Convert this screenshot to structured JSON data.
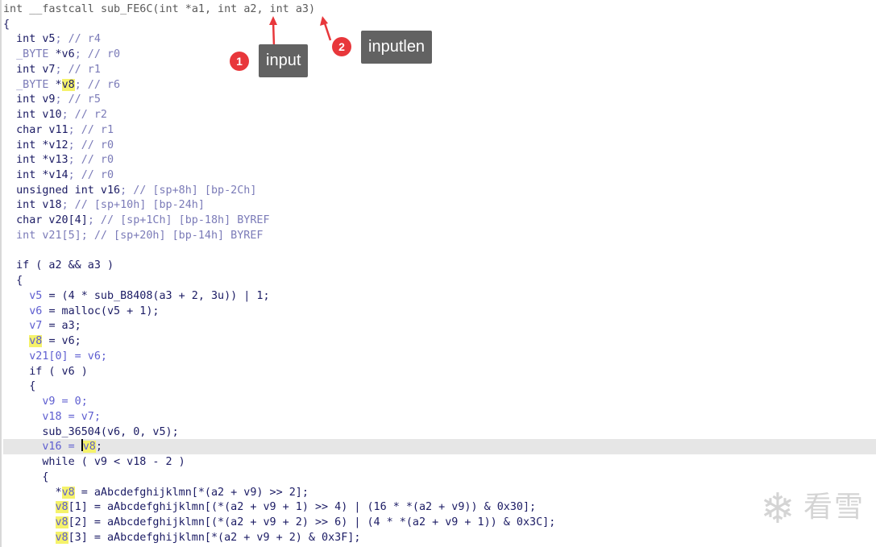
{
  "function_signature": {
    "int_kw": "int",
    "callconv": "__fastcall",
    "name": "sub_FE6C(int *",
    "a1": "a1",
    "sep1": ", int ",
    "a2": "a2",
    "sep2": ", int ",
    "a3": "a3",
    "close": ")"
  },
  "open_brace": "{",
  "declarations": [
    {
      "type": "int",
      "name": " v5",
      "comment": "; // r4"
    },
    {
      "type": "_BYTE",
      "name": " *v6",
      "comment": "; // r0"
    },
    {
      "type": "int",
      "name": " v7",
      "comment": "; // r1"
    },
    {
      "type": "_BYTE",
      "name_prefix": " *",
      "name": "v8",
      "comment": "; // r6"
    },
    {
      "type": "int",
      "name": " v9",
      "comment": "; // r5"
    },
    {
      "type": "int",
      "name": " v10",
      "comment": "; // r2"
    },
    {
      "type": "char",
      "name": " v11",
      "comment": "; // r1"
    },
    {
      "type": "int",
      "name": " *v12",
      "comment": "; // r0"
    },
    {
      "type": "int",
      "name": " *v13",
      "comment": "; // r0"
    },
    {
      "type": "int",
      "name": " *v14",
      "comment": "; // r0"
    },
    {
      "type": "unsigned int",
      "name": " v16",
      "comment": "; // [sp+8h] [bp-2Ch]"
    },
    {
      "type": "int",
      "name": " v18",
      "comment": "; // [sp+10h] [bp-24h]"
    },
    {
      "type": "char",
      "name": " v20[4]",
      "comment": "; // [sp+1Ch] [bp-18h] BYREF"
    },
    {
      "type": "int",
      "name": " v21[5]",
      "comment": "; // [sp+20h] [bp-14h] BYREF"
    }
  ],
  "code": {
    "if_a2_a3": "if ( a2 && a3 )",
    "brace1": "{",
    "l_v5": "= (4 * sub_B8408(a3 + 2, 3u)) | 1;",
    "l_v6": "= malloc(v5 + 1);",
    "l_v7": "= a3;",
    "l_v8": "= v6;",
    "l_v21": "v21[0] = v6;",
    "if_v6": "if ( v6 )",
    "brace2": "{",
    "l_v9": "v9 = 0;",
    "l_v18": "v18 = v7;",
    "l_memset": "sub_36504(v6, 0, v5);",
    "l_v16_pre": "v16 = ",
    "l_v16_var": "v8",
    "l_v16_post": ";",
    "while": "while ( v9 < v18 - 2 )",
    "brace3": "{",
    "l_b0": " = aAbcdefghijklmn[*(a2 + v9) >> 2];",
    "l_b1": "[1] = aAbcdefghijklmn[(*(a2 + v9 + 1) >> 4) | (16 * *(a2 + v9)) & 0x30];",
    "l_b2": "[2] = aAbcdefghijklmn[(*(a2 + v9 + 2) >> 6) | (4 * *(a2 + v9 + 1)) & 0x3C];",
    "l_b3": "[3] = aAbcdefghijklmn[*(a2 + v9 + 2) & 0x3F];"
  },
  "annotations": {
    "one_number": "1",
    "one_label": "input",
    "two_number": "2",
    "two_label": "inputlen"
  },
  "watermark": {
    "text": "看雪",
    "glyph": "❄"
  },
  "colors": {
    "highlight": "#f5f26a",
    "badge": "#e8373b",
    "callout": "#626262",
    "arrow": "#e8373b"
  }
}
